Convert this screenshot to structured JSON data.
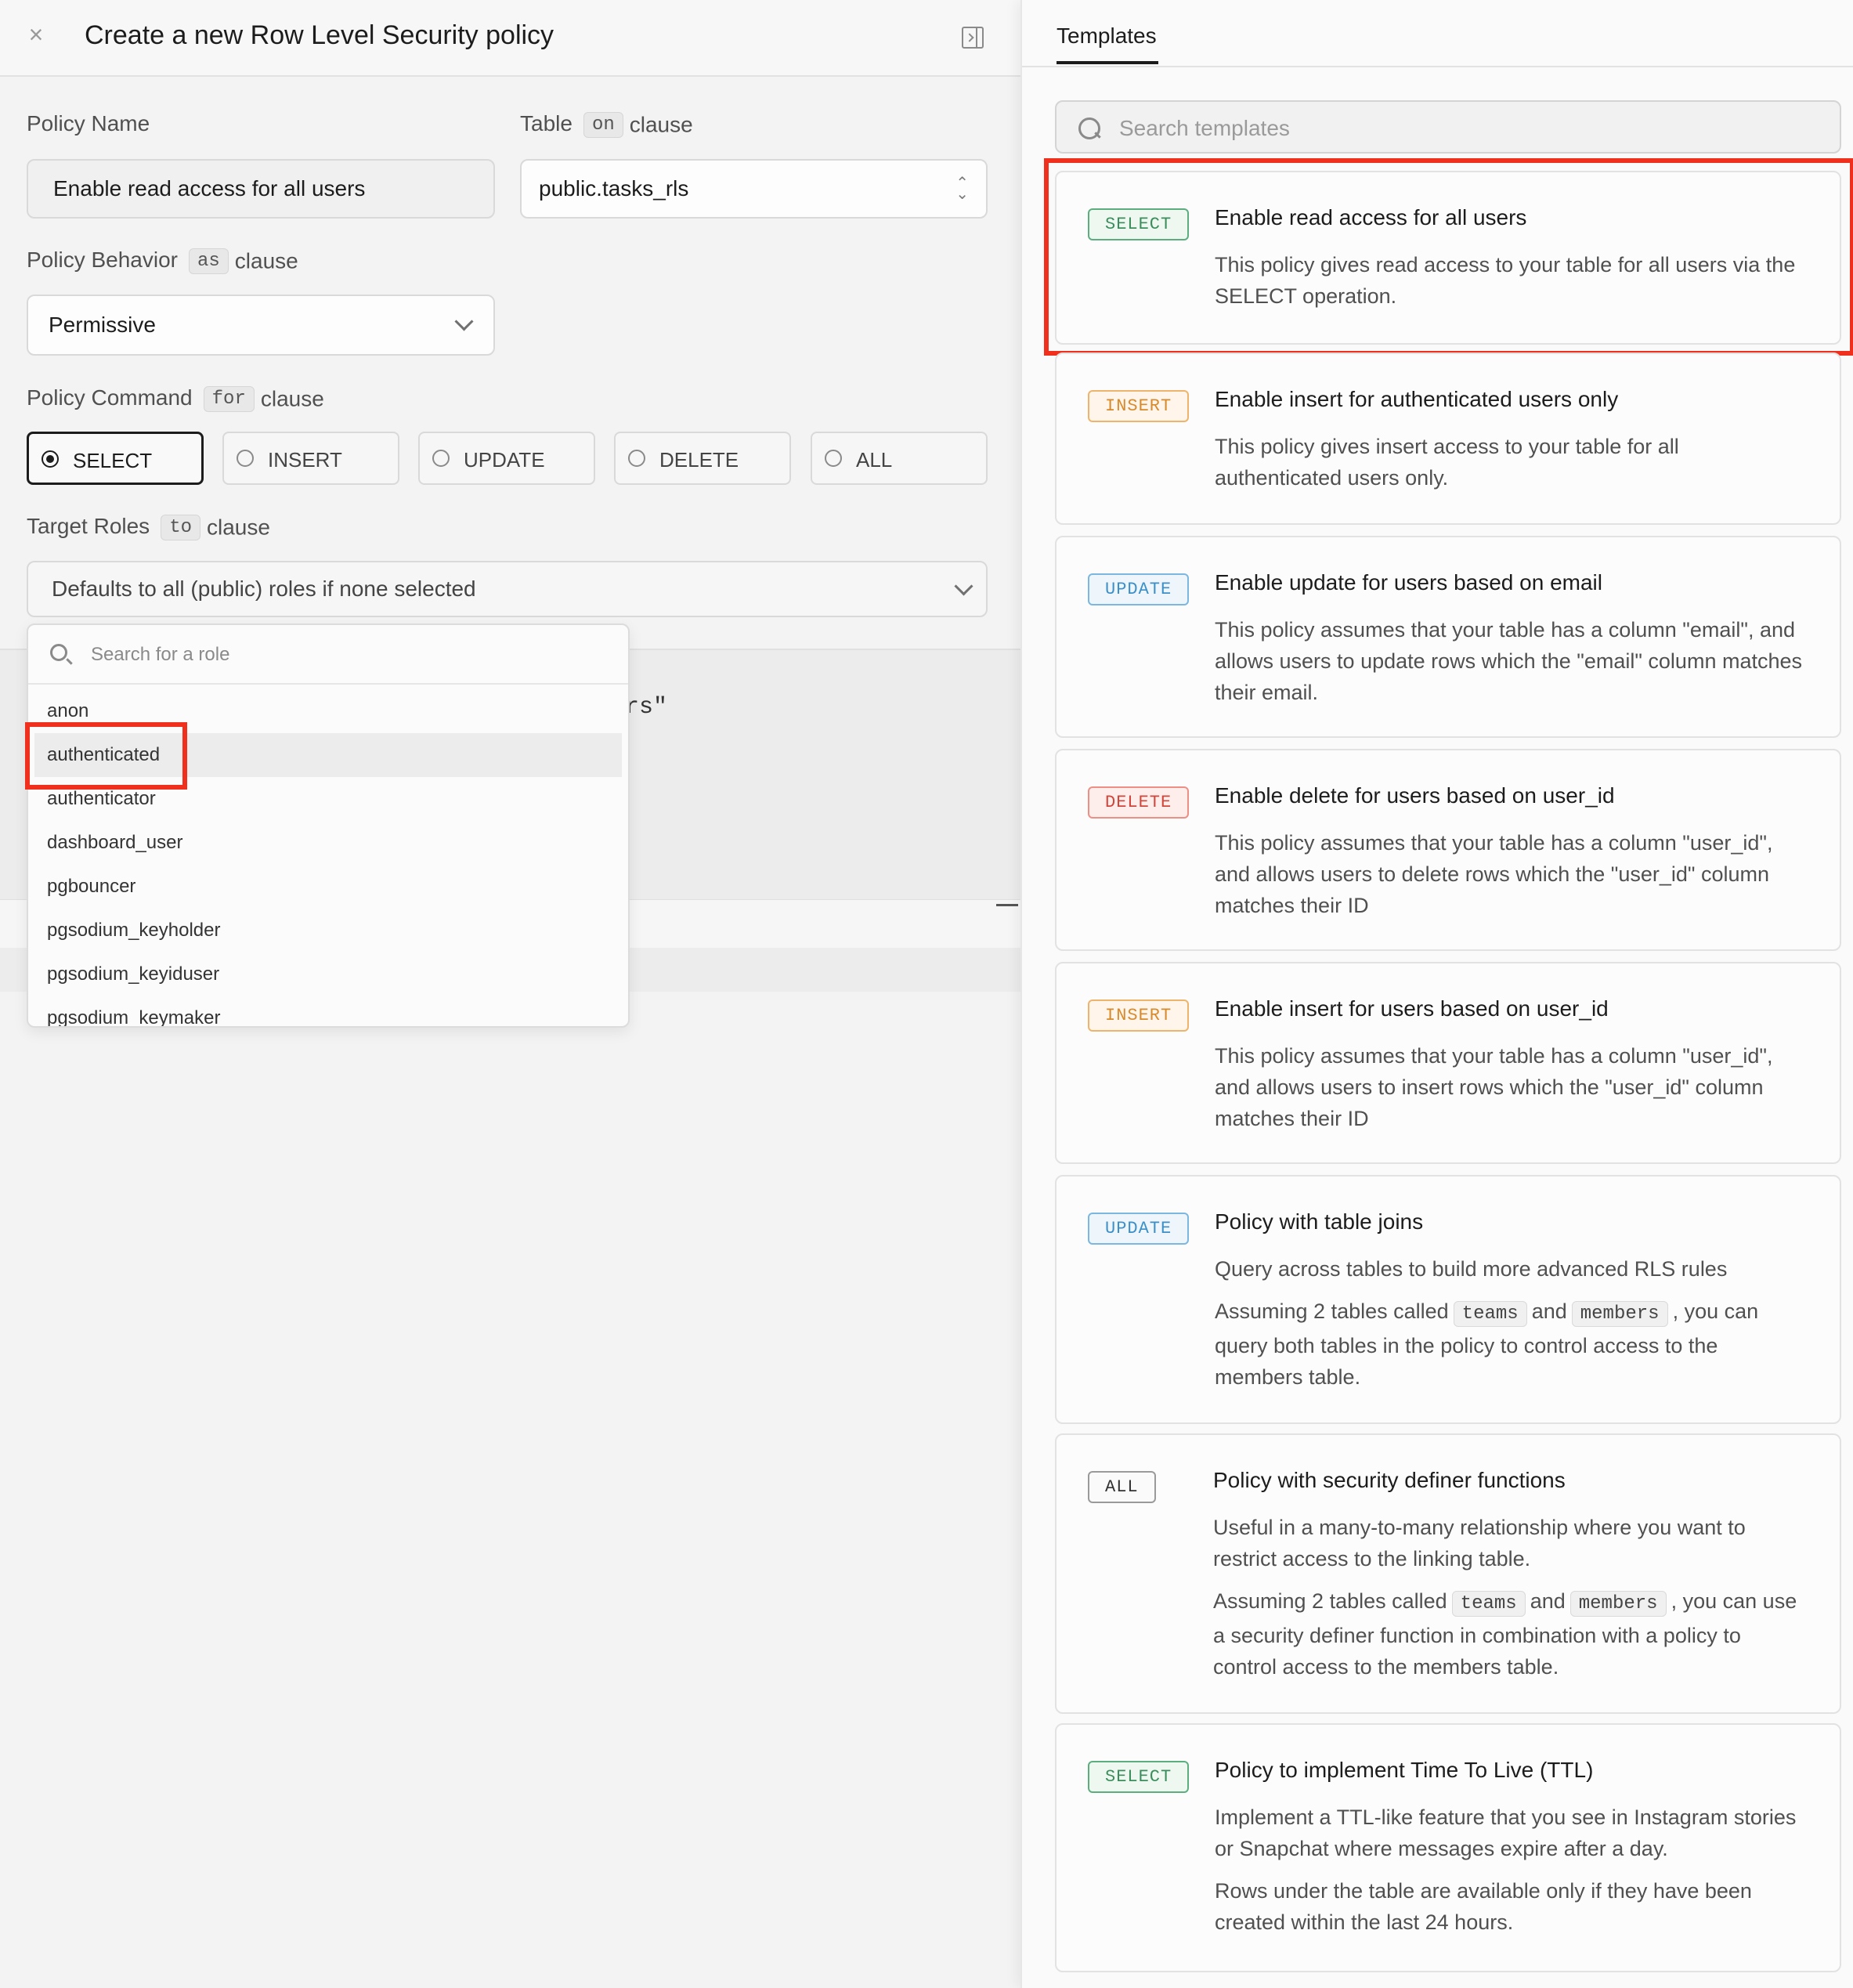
{
  "header": {
    "close_icon": "close-icon",
    "title": "Create a new Row Level Security policy",
    "collapse_icon": "collapse-panel-icon"
  },
  "form": {
    "policy_name": {
      "label": "Policy Name",
      "value": "Enable read access for all users"
    },
    "table": {
      "label": "Table",
      "keyword": "on",
      "clause": "clause",
      "value": "public.tasks_rls"
    },
    "behavior": {
      "label": "Policy Behavior",
      "keyword": "as",
      "clause": "clause",
      "value": "Permissive"
    },
    "command": {
      "label": "Policy Command",
      "keyword": "for",
      "clause": "clause",
      "options": [
        "SELECT",
        "INSERT",
        "UPDATE",
        "DELETE",
        "ALL"
      ],
      "selected": "SELECT"
    },
    "roles": {
      "label": "Target Roles",
      "keyword": "to",
      "clause": "clause",
      "placeholder": "Defaults to all (public) roles if none selected"
    }
  },
  "role_dropdown": {
    "search_placeholder": "Search for a role",
    "items": [
      "anon",
      "authenticated",
      "authenticator",
      "dashboard_user",
      "pgbouncer",
      "pgsodium_keyholder",
      "pgsodium_keyiduser",
      "pgsodium_keymaker"
    ],
    "highlighted": "authenticated"
  },
  "editor": {
    "visible_fragment": "rs\""
  },
  "templates": {
    "tab": "Templates",
    "search_placeholder": "Search templates",
    "cards": [
      {
        "badge": "SELECT",
        "title": "Enable read access for all users",
        "desc": "This policy gives read access to your table for all users via the SELECT operation."
      },
      {
        "badge": "INSERT",
        "title": "Enable insert for authenticated users only",
        "desc": "This policy gives insert access to your table for all authenticated users only."
      },
      {
        "badge": "UPDATE",
        "title": "Enable update for users based on email",
        "desc": "This policy assumes that your table has a column \"email\", and allows users to update rows which the \"email\" column matches their email."
      },
      {
        "badge": "DELETE",
        "title": "Enable delete for users based on user_id",
        "desc": "This policy assumes that your table has a column \"user_id\", and allows users to delete rows which the \"user_id\" column matches their ID"
      },
      {
        "badge": "INSERT",
        "title": "Enable insert for users based on user_id",
        "desc": "This policy assumes that your table has a column \"user_id\", and allows users to insert rows which the \"user_id\" column matches their ID"
      },
      {
        "badge": "UPDATE",
        "title": "Policy with table joins",
        "desc": "Query across tables to build more advanced RLS rules",
        "desc2_a": "Assuming 2 tables called",
        "code1": "teams",
        "desc2_b": "and",
        "code2": "members",
        "desc2_c": ", you can",
        "desc2_d": "query both tables in the policy to control access to the members table."
      },
      {
        "badge": "ALL",
        "title": "Policy with security definer functions",
        "desc": "Useful in a many-to-many relationship where you want to restrict access to the linking table.",
        "desc2_a": "Assuming 2 tables called",
        "code1": "teams",
        "desc2_b": "and",
        "code2": "members",
        "desc2_c": ", you can",
        "desc2_d": "use a security definer function in combination with a policy to control access to the members table."
      },
      {
        "badge": "SELECT",
        "title": "Policy to implement Time To Live (TTL)",
        "desc": "Implement a TTL-like feature that you see in Instagram stories or Snapchat where messages expire after a day.",
        "desc2": "Rows under the table are available only if they have been created within the last 24 hours."
      }
    ]
  },
  "colors": {
    "highlight": "#f0301c",
    "select": "#3b8e5c",
    "insert": "#d88a2b",
    "update": "#3d8fc8",
    "delete": "#d2453a"
  }
}
